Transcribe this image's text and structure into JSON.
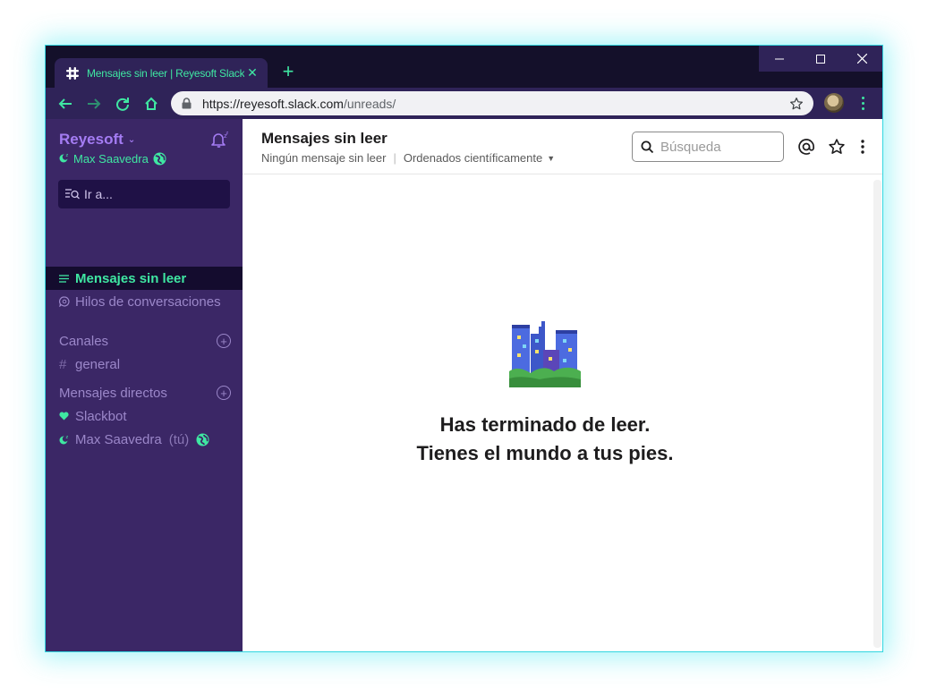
{
  "browser": {
    "tab_title": "Mensajes sin leer | Reyesoft Slack",
    "url_host": "https://reyesoft.slack.com",
    "url_path": "/unreads/"
  },
  "sidebar": {
    "workspace": "Reyesoft",
    "user": "Max Saavedra",
    "jump_placeholder": "Ir a...",
    "nav": [
      {
        "label": "Mensajes sin leer"
      },
      {
        "label": "Hilos de conversaciones"
      }
    ],
    "channels_heading": "Canales",
    "channels": [
      {
        "label": "general"
      }
    ],
    "dm_heading": "Mensajes directos",
    "dms": [
      {
        "label": "Slackbot"
      },
      {
        "label": "Max Saavedra",
        "suffix": "(tú)"
      }
    ]
  },
  "main": {
    "title": "Mensajes sin leer",
    "subtitle_count": "Ningún mensaje sin leer",
    "subtitle_sort": "Ordenados científicamente",
    "search_placeholder": "Búsqueda",
    "empty_line1": "Has terminado de leer.",
    "empty_line2": "Tienes el mundo a tus pies."
  },
  "colors": {
    "accent": "#3fe7a2",
    "sidebar_bg": "#3b2766",
    "chrome_bg": "#2f2358",
    "workspace_name": "#a47cf3"
  },
  "icons": [
    "slack-favicon",
    "close-icon",
    "plus-icon",
    "back-icon",
    "forward-icon",
    "reload-icon",
    "home-icon",
    "lock-icon",
    "star-icon",
    "bell-icon",
    "search-icon",
    "at-icon",
    "more-icon",
    "city-emoji"
  ]
}
